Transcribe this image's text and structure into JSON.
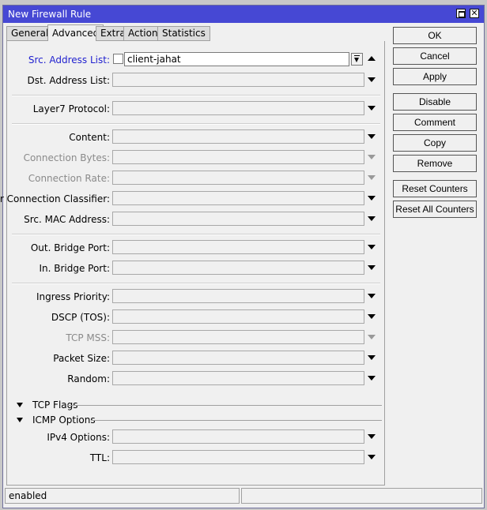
{
  "window": {
    "title": "New Firewall Rule"
  },
  "tabs": [
    {
      "label": "General",
      "active": false
    },
    {
      "label": "Advanced",
      "active": true
    },
    {
      "label": "Extra",
      "active": false
    },
    {
      "label": "Action",
      "active": false
    },
    {
      "label": "Statistics",
      "active": false
    }
  ],
  "fields": {
    "src_address_list": {
      "label": "Src. Address List:",
      "value": "client-jahat"
    },
    "dst_address_list": {
      "label": "Dst. Address List:",
      "value": ""
    },
    "layer7_protocol": {
      "label": "Layer7 Protocol:",
      "value": ""
    },
    "content": {
      "label": "Content:",
      "value": ""
    },
    "connection_bytes": {
      "label": "Connection Bytes:",
      "value": ""
    },
    "connection_rate": {
      "label": "Connection Rate:",
      "value": ""
    },
    "per_connection_classifier": {
      "label": "Per Connection Classifier:",
      "value": ""
    },
    "src_mac_address": {
      "label": "Src. MAC Address:",
      "value": ""
    },
    "out_bridge_port": {
      "label": "Out. Bridge Port:",
      "value": ""
    },
    "in_bridge_port": {
      "label": "In. Bridge Port:",
      "value": ""
    },
    "ingress_priority": {
      "label": "Ingress Priority:",
      "value": ""
    },
    "dscp_tos": {
      "label": "DSCP (TOS):",
      "value": ""
    },
    "tcp_mss": {
      "label": "TCP MSS:",
      "value": ""
    },
    "packet_size": {
      "label": "Packet Size:",
      "value": ""
    },
    "random": {
      "label": "Random:",
      "value": ""
    },
    "ipv4_options": {
      "label": "IPv4 Options:",
      "value": ""
    },
    "ttl": {
      "label": "TTL:",
      "value": ""
    }
  },
  "sections": {
    "tcp_flags": "TCP Flags",
    "icmp_options": "ICMP Options"
  },
  "buttons": {
    "ok": "OK",
    "cancel": "Cancel",
    "apply": "Apply",
    "disable": "Disable",
    "comment": "Comment",
    "copy": "Copy",
    "remove": "Remove",
    "reset_counters": "Reset Counters",
    "reset_all_counters": "Reset All Counters"
  },
  "status": {
    "state": "enabled"
  },
  "colors": {
    "titlebar": "#4648d4",
    "src_label": "#1f1fcf",
    "disabled_label": "#8a8a8a"
  }
}
